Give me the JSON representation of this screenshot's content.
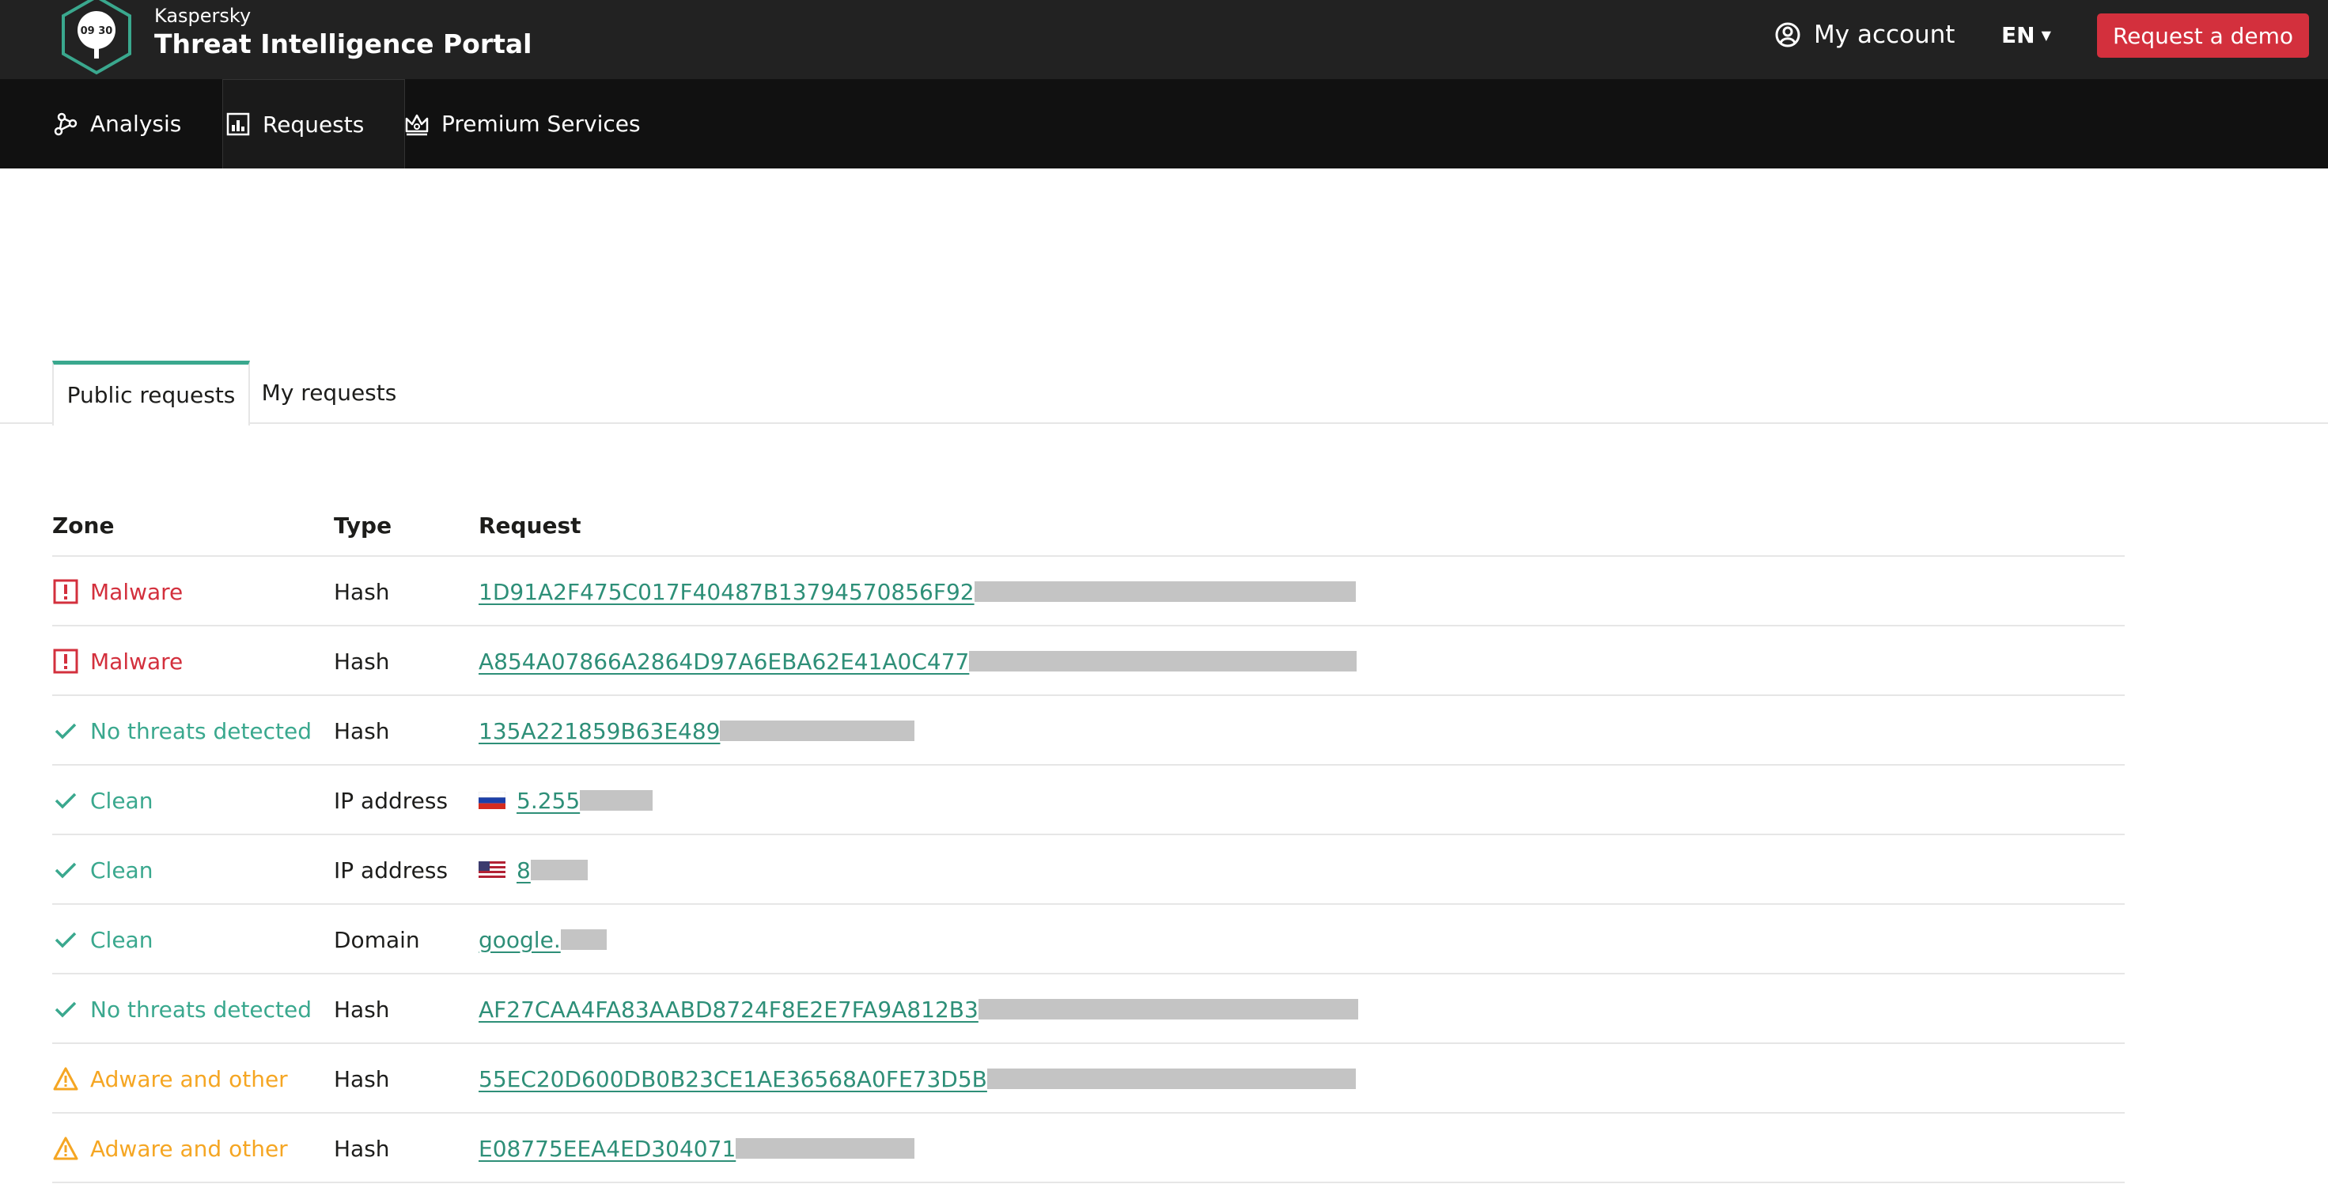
{
  "header": {
    "brand_small": "Kaspersky",
    "brand_title": "Threat Intelligence Portal",
    "logo_text": "09 30",
    "account_label": "My account",
    "language": "EN",
    "demo_button": "Request a demo"
  },
  "nav": {
    "items": [
      {
        "label": "Analysis",
        "icon": "analysis-icon"
      },
      {
        "label": "Requests",
        "icon": "requests-chart-icon",
        "active": true
      },
      {
        "label": "Premium Services",
        "icon": "crown-icon"
      }
    ]
  },
  "tabs": [
    {
      "label": "Public requests",
      "active": true
    },
    {
      "label": "My requests",
      "active": false
    }
  ],
  "table": {
    "columns": [
      "Zone",
      "Type",
      "Request"
    ],
    "rows": [
      {
        "zone": "Malware",
        "zone_kind": "malware",
        "type": "Hash",
        "request": "1D91A2F475C017F40487B13794570856F92",
        "flag": null
      },
      {
        "zone": "Malware",
        "zone_kind": "malware",
        "type": "Hash",
        "request": "A854A07866A2864D97A6EBA62E41A0C477",
        "flag": null
      },
      {
        "zone": "No threats detected",
        "zone_kind": "clean",
        "type": "Hash",
        "request": "135A221859B63E489",
        "flag": null
      },
      {
        "zone": "Clean",
        "zone_kind": "clean",
        "type": "IP address",
        "request": "5.255",
        "flag": "ru"
      },
      {
        "zone": "Clean",
        "zone_kind": "clean",
        "type": "IP address",
        "request": "8",
        "flag": "us"
      },
      {
        "zone": "Clean",
        "zone_kind": "clean",
        "type": "Domain",
        "request": "google.",
        "flag": null
      },
      {
        "zone": "No threats detected",
        "zone_kind": "clean",
        "type": "Hash",
        "request": "AF27CAA4FA83AABD8724F8E2E7FA9A812B3",
        "flag": null
      },
      {
        "zone": "Adware and other",
        "zone_kind": "adware",
        "type": "Hash",
        "request": "55EC20D600DB0B23CE1AE36568A0FE73D5B",
        "flag": null
      },
      {
        "zone": "Adware and other",
        "zone_kind": "adware",
        "type": "Hash",
        "request": "E08775EEA4ED304071",
        "flag": null
      }
    ]
  },
  "colors": {
    "accent_green": "#3aa88e",
    "malware_red": "#d3303d",
    "adware_orange": "#f5a623",
    "topbar_bg": "#222222"
  }
}
